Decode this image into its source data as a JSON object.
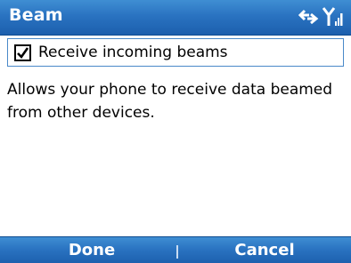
{
  "titlebar": {
    "title": "Beam",
    "icons": [
      "connection-icon",
      "signal-icon"
    ]
  },
  "setting": {
    "label": "Receive incoming beams",
    "checked": true
  },
  "description": "Allows your phone to receive data beamed from other devices.",
  "softkeys": {
    "left": "Done",
    "right": "Cancel"
  },
  "colors": {
    "bar": "#2a73c1",
    "bar_text": "#ffffff",
    "focus_border": "#4a89c9"
  }
}
